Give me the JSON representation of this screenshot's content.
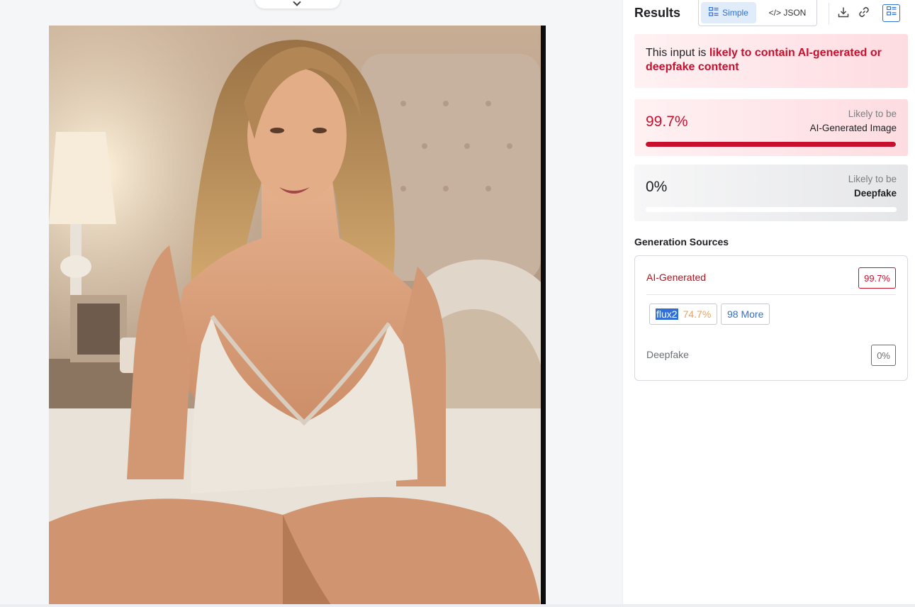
{
  "header": {
    "title": "Results",
    "view_simple": "Simple",
    "view_json": "</> JSON"
  },
  "verdict": {
    "prefix": "This input is ",
    "highlight": "likely to contain AI-generated or deepfake content"
  },
  "scores": {
    "ai": {
      "percent": "99.7%",
      "fill_fraction": 0.997,
      "label_top": "Likely to be",
      "label_bottom": "AI-Generated Image"
    },
    "deepfake": {
      "percent": "0%",
      "fill_fraction": 0,
      "label_top": "Likely to be",
      "label_bottom": "Deepfake"
    }
  },
  "sources": {
    "title": "Generation Sources",
    "ai_label": "AI-Generated",
    "ai_value": "99.7%",
    "model_name": "flux2",
    "model_value": "74.7%",
    "more_label": "98 More",
    "deepfake_label": "Deepfake",
    "deepfake_value": "0%"
  },
  "colors": {
    "accent_red": "#c8102e",
    "accent_blue": "#2f6fd6",
    "model_value_orange": "#e8a25a"
  },
  "icons": {
    "simple_view": "list-layout-icon",
    "download": "download-icon",
    "link": "link-icon",
    "layout": "layout-panel-icon",
    "preview_toggle": "chevron-down-icon"
  }
}
